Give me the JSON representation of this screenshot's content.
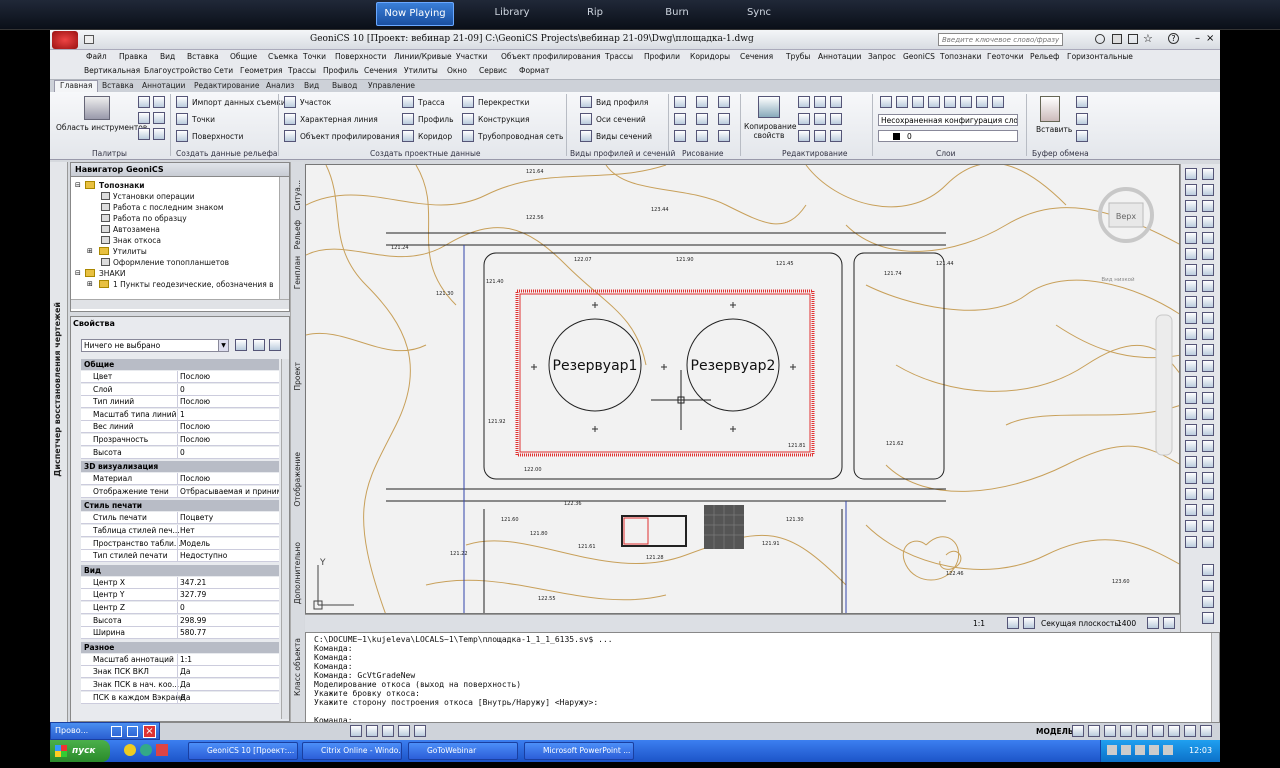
{
  "player": {
    "tabs": [
      "Now Playing",
      "Library",
      "Rip",
      "Burn",
      "Sync"
    ],
    "active": "Now Playing"
  },
  "app": {
    "title": "GeoniCS 10 [Проект: вебинар 21-09]    C:\\GeoniCS Projects\\вебинар 21-09\\Dwg\\площадка-1.dwg",
    "search_placeholder": "Введите ключевое слово/фразу"
  },
  "menu": {
    "row1": [
      "Файл",
      "Правка",
      "Вид",
      "Вставка",
      "Общие",
      "Съемка",
      "Точки",
      "Поверхности",
      "Линии/Кривые",
      "Участки",
      "Объект профилирования",
      "Трассы",
      "Профили",
      "Коридоры",
      "Сечения",
      "Трубы",
      "Аннотации",
      "Запрос",
      "GeoniCS",
      "Топознаки",
      "Геоточки",
      "Рельеф",
      "Горизонтальные"
    ],
    "row2": [
      "Вертикальная",
      "Благоустройство",
      "Сети",
      "Геометрия",
      "Трассы",
      "Профиль",
      "Сечения",
      "Утилиты",
      "Окно",
      "Сервис",
      "Формат"
    ]
  },
  "ribbon_tabs": [
    "Главная",
    "Вставка",
    "Аннотации",
    "Редактирование",
    "Анализ",
    "Вид",
    "Вывод",
    "Управление"
  ],
  "ribbon": {
    "tool_area": "Область инструментов",
    "import_survey": "Импорт данных съемки",
    "points": "Точки",
    "surfaces": "Поверхности",
    "parcel": "Участок",
    "feature_line": "Характерная линия",
    "grading": "Объект профилирования",
    "alignment": "Трасса",
    "profile": "Профиль",
    "corridor": "Коридор",
    "intersections": "Перекрестки",
    "assembly": "Конструкция",
    "pipe_network": "Трубопроводная сеть",
    "profile_view": "Вид профиля",
    "section_lines": "Оси сечений",
    "section_views": "Виды сечений",
    "copy_props": "Копирование свойств",
    "layer_state": "Несохраненная конфигурация слое",
    "layer_current": "0",
    "paste": "Вставить",
    "groups": [
      "Палитры",
      "Создать данные рельефа",
      "Создать проектные данные",
      "Виды профилей и сечений",
      "Рисование",
      "Редактирование",
      "Слои",
      "Буфер обмена"
    ]
  },
  "left_strip_label": "Диспетчер восстановления чертежей",
  "navigator": {
    "title": "Навигатор GeoniCS",
    "items": [
      "Топознаки",
      "Установки операции",
      "Работа с последним знаком",
      "Работа по образцу",
      "Автозамена",
      "Знак откоса",
      "Утилиты",
      "Оформление топопланшетов",
      "ЗНАКИ",
      "1 Пункты геодезические, обозначения высот"
    ]
  },
  "side_tabs": [
    "Ситуа...",
    "Рельеф",
    "Генплан",
    "Проект",
    "Отображение",
    "Дополнительно",
    "Класс объекта"
  ],
  "properties": {
    "title": "Свойства",
    "selection": "Ничего не выбрано",
    "sections": [
      {
        "name": "Общие",
        "rows": [
          [
            "Цвет",
            "Послою"
          ],
          [
            "Слой",
            "0"
          ],
          [
            "Тип линий",
            "Послою"
          ],
          [
            "Масштаб типа линий",
            "1"
          ],
          [
            "Вес линий",
            "Послою"
          ],
          [
            "Прозрачность",
            "Послою"
          ],
          [
            "Высота",
            "0"
          ]
        ]
      },
      {
        "name": "3D визуализация",
        "rows": [
          [
            "Материал",
            "Послою"
          ],
          [
            "Отображение тени",
            "Отбрасываемая и принима..."
          ]
        ]
      },
      {
        "name": "Стиль печати",
        "rows": [
          [
            "Стиль печати",
            "Поцвету"
          ],
          [
            "Таблица стилей печ...",
            "Нет"
          ],
          [
            "Пространство табли...",
            "Модель"
          ],
          [
            "Тип стилей печати",
            "Недоступно"
          ]
        ]
      },
      {
        "name": "Вид",
        "rows": [
          [
            "Центр X",
            "347.21"
          ],
          [
            "Центр Y",
            "327.79"
          ],
          [
            "Центр Z",
            "0"
          ],
          [
            "Высота",
            "298.99"
          ],
          [
            "Ширина",
            "580.77"
          ]
        ]
      },
      {
        "name": "Разное",
        "rows": [
          [
            "Масштаб аннотаций",
            "1:1"
          ],
          [
            "Знак ПСК ВКЛ",
            "Да"
          ],
          [
            "Знак ПСК в нач. коо...",
            "Да"
          ],
          [
            "ПСК в каждом Вэкране",
            "Да"
          ]
        ]
      }
    ]
  },
  "drawing": {
    "tank1": "Резервуар1",
    "tank2": "Резервуар2",
    "view_label": "Верх",
    "compass": "Вид низкой",
    "elevations": [
      "121.64",
      "122.56",
      "123.44",
      "121.30",
      "121.40",
      "122.07",
      "121.90",
      "121.45",
      "121.74",
      "121.44",
      "121.24",
      "121.92",
      "122.00",
      "121.81",
      "121.62",
      "122.36",
      "121.60",
      "121.80",
      "121.61",
      "121.28",
      "121.30",
      "121.91",
      "121.22",
      "122.55",
      "122.46",
      "123.60"
    ]
  },
  "status1": {
    "scale": "1:1",
    "section_plane": "Секущая плоскость:",
    "section_value": "1400"
  },
  "command": {
    "lines": [
      "C:\\DOCUME~1\\kujeleva\\LOCALS~1\\Temp\\площадка-1_1_1_6135.sv$ ...",
      "Команда:",
      "Команда:",
      "Команда:",
      "Команда: GcVtGradeNew",
      "Моделирование откоса (выход на поверхность)",
      "Укажите бровку откоса:",
      "Укажите сторону построения откоса [Внутрь/Наружу] <Наружу>:",
      "",
      "Команда:"
    ]
  },
  "status2": {
    "model": "МОДЕЛЬ"
  },
  "taskbar": {
    "start": "пуск",
    "tasks": [
      "GeoniCS 10 [Проект:...",
      "Citrix Online - Windo...",
      "GoToWebinar",
      "Microsoft PowerPoint ..."
    ],
    "lang": "RU",
    "clock": "12:03",
    "quick": "Прово..."
  }
}
